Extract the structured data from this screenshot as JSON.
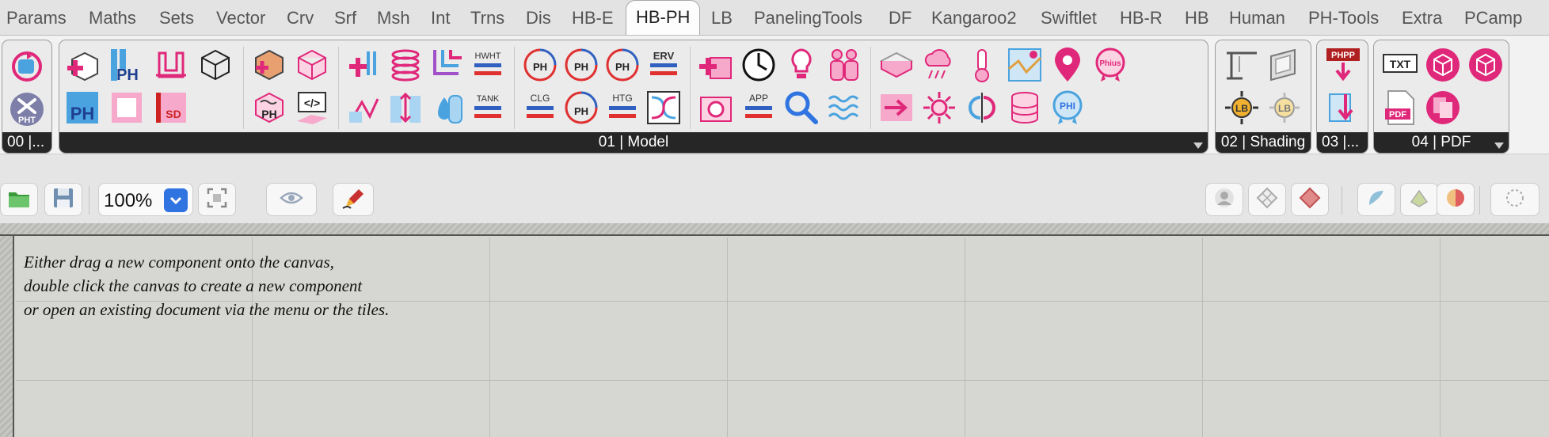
{
  "tabs": [
    "Params",
    "Maths",
    "Sets",
    "Vector",
    "Crv",
    "Srf",
    "Msh",
    "Int",
    "Trns",
    "Dis",
    "HB-E",
    "HB-PH",
    "LB",
    "PanelingTools",
    "DF",
    "Kangaroo2",
    "Swiftlet",
    "HB-R",
    "HB",
    "Human",
    "PH-Tools",
    "Extra",
    "PCamp"
  ],
  "active_tab": "HB-PH",
  "ribbon": {
    "groups": [
      {
        "label": "00 |..."
      },
      {
        "label": "01 | Model"
      },
      {
        "label": "02 | Shading"
      },
      {
        "label": "03 |..."
      },
      {
        "label": "04 | PDF"
      }
    ],
    "icon_text": {
      "pht": "PHT",
      "ph": "PH",
      "sd": "SD",
      "code": "</>",
      "hwht": "HWHT",
      "tank": "TANK",
      "clg": "CLG",
      "htg": "HTG",
      "erv": "ERV",
      "app": "APP",
      "phius": "Phius",
      "phi": "PHI",
      "lb": "LB",
      "phpp": "PHPP",
      "txt": "TXT",
      "pdf": "PDF"
    }
  },
  "toolbar": {
    "zoom": "100%",
    "icons": [
      "open-folder-icon",
      "save-icon",
      "zoom-select-icon",
      "zoom-extents-icon",
      "preview-eye-icon",
      "sketch-pen-icon",
      "display-wire-icon",
      "display-mesh-icon",
      "display-shaded-icon",
      "preview-blue-icon",
      "preview-green-icon",
      "preview-selected-icon",
      "circle-icon"
    ]
  },
  "canvas": {
    "hint_lines": [
      "Either drag a new component onto the canvas,",
      "double click the canvas to create a new component",
      "or open an existing document via the menu or the tiles."
    ]
  },
  "colors": {
    "accent_pink": "#e0287a",
    "accent_blue": "#2f74e0",
    "panel_dark": "#262626"
  }
}
